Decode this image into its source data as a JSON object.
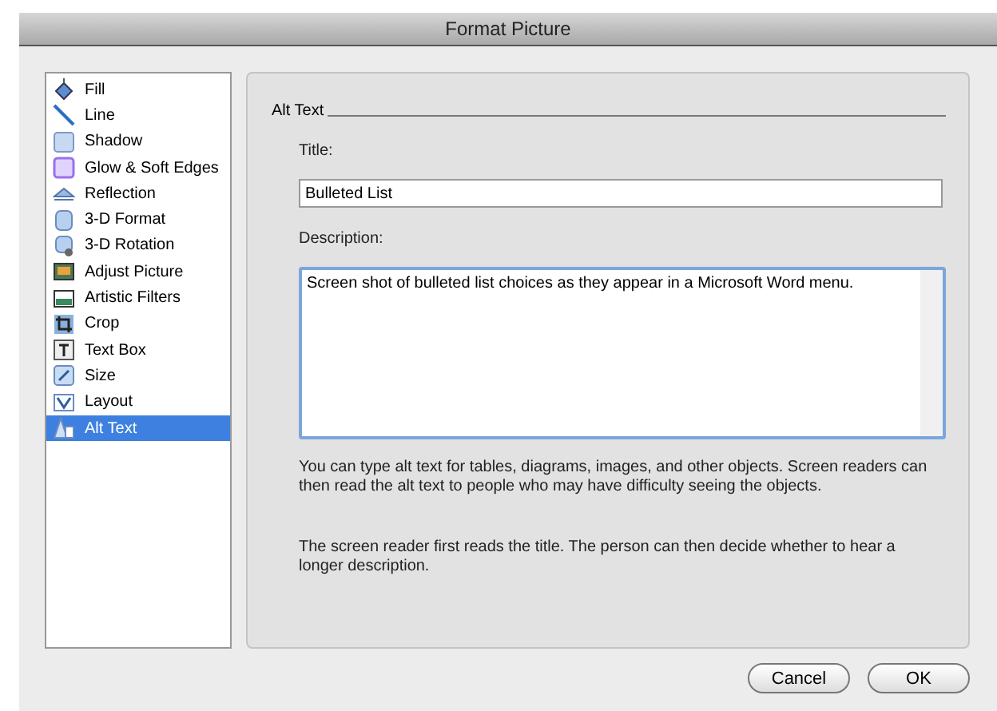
{
  "window": {
    "title": "Format Picture"
  },
  "sidebar": {
    "items": [
      {
        "label": "Fill",
        "selected": false
      },
      {
        "label": "Line",
        "selected": false
      },
      {
        "label": "Shadow",
        "selected": false
      },
      {
        "label": "Glow & Soft Edges",
        "selected": false
      },
      {
        "label": "Reflection",
        "selected": false
      },
      {
        "label": "3-D Format",
        "selected": false
      },
      {
        "label": "3-D Rotation",
        "selected": false
      },
      {
        "label": "Adjust Picture",
        "selected": false
      },
      {
        "label": "Artistic Filters",
        "selected": false
      },
      {
        "label": "Crop",
        "selected": false
      },
      {
        "label": "Text Box",
        "selected": false
      },
      {
        "label": "Size",
        "selected": false
      },
      {
        "label": "Layout",
        "selected": false
      },
      {
        "label": "Alt Text",
        "selected": true
      }
    ]
  },
  "panel": {
    "heading": "Alt Text",
    "title_label": "Title:",
    "title_value": "Bulleted List",
    "description_label": "Description:",
    "description_value": "Screen shot of bulleted list choices as they appear in a Microsoft Word menu.",
    "notes": [
      "You can type alt text for tables, diagrams, images, and other objects. Screen readers can then read the alt text to people who may have difficulty seeing the objects.",
      "The screen reader first reads the title. The person can then decide whether to hear a longer description."
    ]
  },
  "buttons": [
    {
      "label": "Cancel",
      "default": false
    },
    {
      "label": "OK",
      "default": false
    }
  ]
}
